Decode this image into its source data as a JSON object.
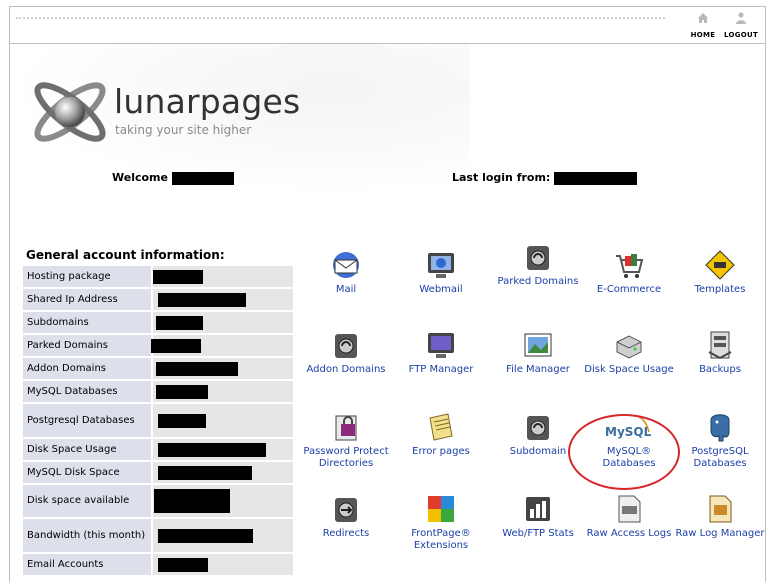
{
  "topbar": {
    "nav": [
      {
        "label": "HOME",
        "icon": "home-icon"
      },
      {
        "label": "LOGOUT",
        "icon": "logout-icon"
      }
    ]
  },
  "brand": {
    "name": "lunarpages",
    "tagline": "taking your site higher"
  },
  "header": {
    "welcome_label": "Welcome",
    "last_login_label": "Last login from:"
  },
  "general": {
    "title": "General account information:",
    "rows": [
      {
        "label": "Hosting package"
      },
      {
        "label": "Shared Ip Address"
      },
      {
        "label": "Subdomains"
      },
      {
        "label": "Parked Domains"
      },
      {
        "label": "Addon Domains"
      },
      {
        "label": "MySQL Databases"
      },
      {
        "label": "Postgresql Databases"
      },
      {
        "label": "Disk Space Usage"
      },
      {
        "label": "MySQL Disk Space"
      },
      {
        "label": "Disk space available"
      },
      {
        "label": "Bandwidth (this month)"
      },
      {
        "label": "Email Accounts"
      }
    ]
  },
  "tools": [
    {
      "label": "Mail",
      "icon": "mail-icon"
    },
    {
      "label": "Webmail",
      "icon": "webmail-icon"
    },
    {
      "label": "Parked Domains",
      "icon": "parked-domains-icon"
    },
    {
      "label": "E-Commerce",
      "icon": "ecommerce-cart-icon"
    },
    {
      "label": "Templates",
      "icon": "templates-icon"
    },
    {
      "label": "Addon Domains",
      "icon": "addon-domains-icon"
    },
    {
      "label": "FTP Manager",
      "icon": "ftp-manager-icon"
    },
    {
      "label": "File Manager",
      "icon": "file-manager-icon"
    },
    {
      "label": "Disk Space Usage",
      "icon": "disk-space-icon"
    },
    {
      "label": "Backups",
      "icon": "backups-icon"
    },
    {
      "label": "Password Protect Directories",
      "icon": "password-protect-icon"
    },
    {
      "label": "Error pages",
      "icon": "error-pages-icon"
    },
    {
      "label": "Subdomain",
      "icon": "subdomain-icon"
    },
    {
      "label": "MySQL® Databases",
      "icon": "mysql-icon"
    },
    {
      "label": "PostgreSQL Databases",
      "icon": "postgresql-icon"
    },
    {
      "label": "Redirects",
      "icon": "redirects-icon"
    },
    {
      "label": "FrontPage® Extensions",
      "icon": "frontpage-icon"
    },
    {
      "label": "Web/FTP Stats",
      "icon": "stats-icon"
    },
    {
      "label": "Raw Access Logs",
      "icon": "raw-logs-icon"
    },
    {
      "label": "Raw Log Manager",
      "icon": "raw-log-manager-icon"
    }
  ],
  "mysql_logo_text": "MySQL",
  "colors": {
    "link": "#1a3fa8",
    "label_bg": "#dde0ea",
    "highlight_ring": "#d8262b"
  }
}
